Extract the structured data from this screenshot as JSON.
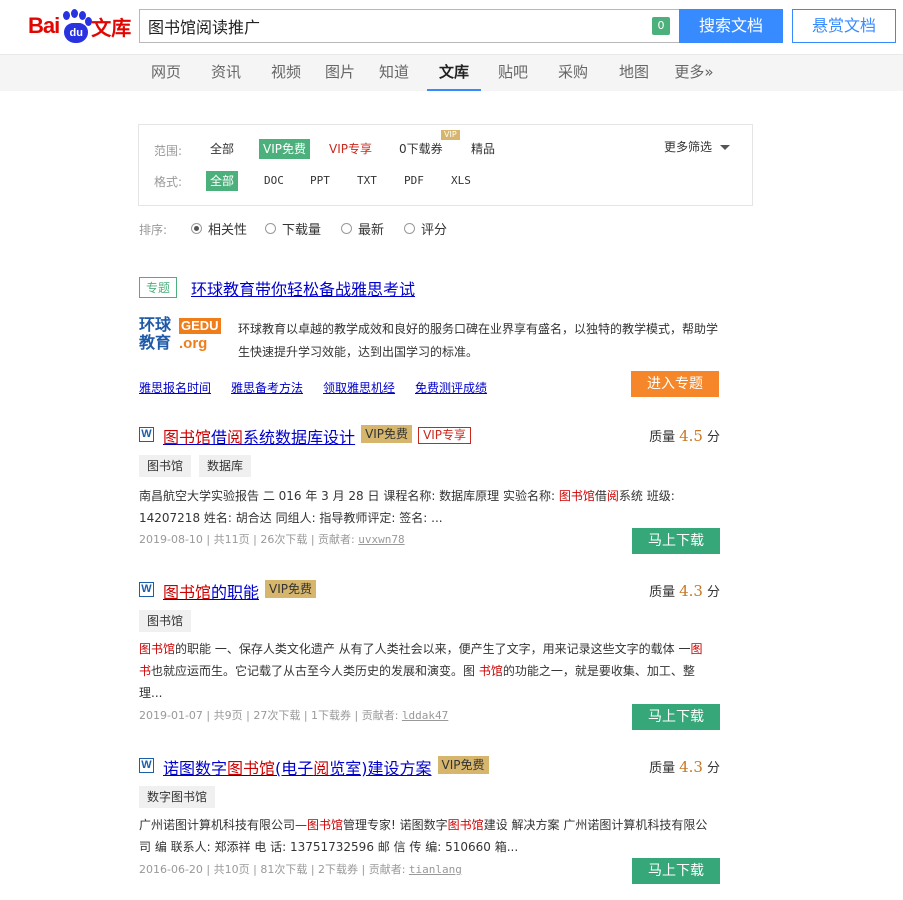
{
  "header": {
    "logo_text_bai": "Bai",
    "logo_text_du": "du",
    "logo_text_wenku": "文库",
    "search_value": "图书馆阅读推广",
    "search_count": "0",
    "search_button": "搜索文档",
    "reward_button": "悬赏文档"
  },
  "nav": {
    "items": [
      "网页",
      "资讯",
      "视频",
      "图片",
      "知道",
      "文库",
      "贴吧",
      "采购",
      "地图",
      "更多»"
    ],
    "active": "文库"
  },
  "filters": {
    "scope_label": "范围:",
    "scope_options": [
      "全部",
      "VIP免费",
      "VIP专享",
      "0下载券",
      "精品"
    ],
    "scope_selected": "VIP免费",
    "vip_mini": "VIP",
    "format_label": "格式:",
    "format_options": [
      "全部",
      "DOC",
      "PPT",
      "TXT",
      "PDF",
      "XLS"
    ],
    "format_selected": "全部",
    "more_filter": "更多筛选"
  },
  "sort": {
    "label": "排序:",
    "options": [
      "相关性",
      "下载量",
      "最新",
      "评分"
    ],
    "selected": "相关性"
  },
  "topic": {
    "tag": "专题",
    "title": "环球教育带你轻松备战雅思考试",
    "logo_cn": "环球教育",
    "logo_en": "GEDU",
    "logo_org": ".org",
    "description": "环球教育以卓越的教学成效和良好的服务口碑在业界享有盛名，以独特的教学模式，帮助学生快速提升学习效能，达到出国学习的标准。",
    "links": [
      "雅思报名时间",
      "雅思备考方法",
      "领取雅思机经",
      "免费测评成绩"
    ],
    "enter_button": "进入专题"
  },
  "results": [
    {
      "title_parts": [
        {
          "text": "图书馆",
          "hl": true
        },
        {
          "text": "借",
          "hl": false
        },
        {
          "text": "阅",
          "hl": true
        },
        {
          "text": "系统数据库设计",
          "hl": false
        }
      ],
      "vip_free": "VIP免费",
      "vip_only": "VIP专享",
      "quality_label": "质量",
      "score": "4.5",
      "score_unit": "分",
      "tags": [
        "图书馆",
        "数据库"
      ],
      "desc_parts": [
        {
          "text": "南昌航空大学实验报告 二 016 年 3 月 28 日 课程名称: 数据库原理 实验名称: ",
          "hl": false
        },
        {
          "text": "图书馆",
          "hl": true
        },
        {
          "text": "借",
          "hl": false
        },
        {
          "text": "阅",
          "hl": true
        },
        {
          "text": "系统 班级: 14207218 姓名: 胡合达 同组人: 指导教师评定: 签名: ...",
          "hl": false
        }
      ],
      "meta": "2019-08-10  | 共11页 | 26次下载 | 贡献者:",
      "uploader": "uvxwn78",
      "download_button": "马上下载"
    },
    {
      "title_parts": [
        {
          "text": "图书馆",
          "hl": true
        },
        {
          "text": "的职能",
          "hl": false
        }
      ],
      "vip_free": "VIP免费",
      "quality_label": "质量",
      "score": "4.3",
      "score_unit": "分",
      "tags": [
        "图书馆"
      ],
      "desc_parts": [
        {
          "text": "图书馆",
          "hl": true
        },
        {
          "text": "的职能 一、保存人类文化遗产 从有了人类社会以来，便产生了文字，用来记录这些文字的载体 一",
          "hl": false
        },
        {
          "text": "图书",
          "hl": true
        },
        {
          "text": "也就应运而生。它记载了从古至今人类历史的发展和演变。图 ",
          "hl": false
        },
        {
          "text": "书馆",
          "hl": true
        },
        {
          "text": "的功能之一，就是要收集、加工、整理...",
          "hl": false
        }
      ],
      "meta": "2019-01-07  | 共9页 | 27次下载 | 1下载券 | 贡献者:",
      "uploader": "lddak47",
      "download_button": "马上下载"
    },
    {
      "title_parts": [
        {
          "text": "诺图数字",
          "hl": false
        },
        {
          "text": "图书馆",
          "hl": true
        },
        {
          "text": "(电子",
          "hl": false
        },
        {
          "text": "阅",
          "hl": true
        },
        {
          "text": "览室)建设方案",
          "hl": false
        }
      ],
      "vip_free": "VIP免费",
      "quality_label": "质量",
      "score": "4.3",
      "score_unit": "分",
      "tags": [
        "数字图书馆"
      ],
      "desc_parts": [
        {
          "text": "广州诺图计算机科技有限公司—",
          "hl": false
        },
        {
          "text": "图书馆",
          "hl": true
        },
        {
          "text": "管理专家! 诺图数字",
          "hl": false
        },
        {
          "text": "图书馆",
          "hl": true
        },
        {
          "text": "建设 解决方案 广州诺图计算机科技有限公司 编 联系人: 郑添祥 电 话: 13751732596 邮 信 传 编: 510660 箱...",
          "hl": false
        }
      ],
      "meta": "2016-06-20  | 共10页 | 81次下载 | 2下载券 | 贡献者:",
      "uploader": "tianlang",
      "download_button": "马上下载"
    }
  ],
  "colors": {
    "accent_blue": "#388bff",
    "green": "#4cb07d",
    "download_green": "#36a779",
    "orange": "#f5872a",
    "vip_gold": "#d6b56d",
    "highlight_red": "#cc0000",
    "link_blue": "#0000cc"
  }
}
